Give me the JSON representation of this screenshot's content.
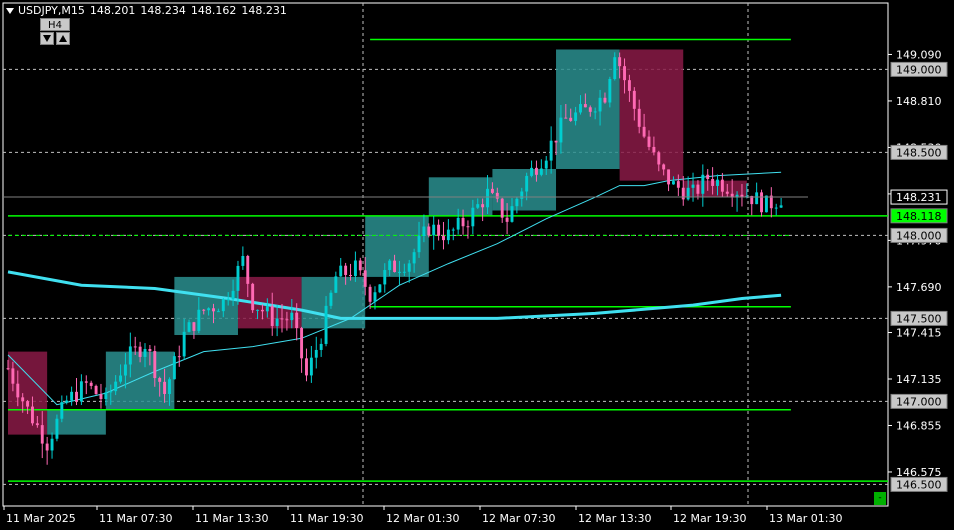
{
  "header": {
    "symbol": "USDJPY,M15",
    "open": "148.201",
    "high": "148.234",
    "low": "148.162",
    "close": "148.231"
  },
  "timeframe": {
    "label": "H4",
    "down_icon": "triangle-down-icon",
    "up_icon": "triangle-up-icon"
  },
  "corner_button": {
    "label": "-"
  },
  "colors": {
    "background": "#000000",
    "frame": "#ffffff",
    "grid": "#c0c0c0",
    "bull": "#00ced1",
    "bear": "#ff69b4",
    "level": "#00ff00",
    "ma_slow": "#40e0f0",
    "ma_fast": "#40e0f0",
    "box_bull": "#2a8f8f",
    "box_bear": "#8a1a46"
  },
  "chart_data": {
    "type": "candlestick",
    "price_min": 146.37,
    "price_max": 149.4,
    "price_ticks": [
      "149.090",
      "148.810",
      "148.530",
      "148.250",
      "147.970",
      "147.690",
      "147.415",
      "147.135",
      "146.855",
      "146.575"
    ],
    "price_tick_values": [
      149.09,
      148.81,
      148.53,
      148.25,
      147.97,
      147.69,
      147.415,
      147.135,
      146.855,
      146.575
    ],
    "time_labels": [
      "11 Mar 2025",
      "11 Mar 07:30",
      "11 Mar 13:30",
      "11 Mar 19:30",
      "12 Mar 01:30",
      "12 Mar 07:30",
      "12 Mar 13:30",
      "12 Mar 19:30",
      "13 Mar 01:30"
    ],
    "bars_total": 160,
    "round_levels": [
      {
        "label": "149.000",
        "value": 149.0
      },
      {
        "label": "148.500",
        "value": 148.5
      },
      {
        "label": "148.000",
        "value": 148.0
      },
      {
        "label": "147.500",
        "value": 147.5
      },
      {
        "label": "147.000",
        "value": 147.0
      },
      {
        "label": "146.500",
        "value": 146.5
      }
    ],
    "current_price": {
      "label": "148.231",
      "value": 148.231
    },
    "marked_level": {
      "label": "148.118",
      "value": 148.118
    },
    "level_lines": [
      {
        "value": 149.18,
        "from": 74,
        "to": 160
      },
      {
        "value": 148.118,
        "from": 0,
        "to": 180
      },
      {
        "value": 147.57,
        "from": 74,
        "to": 160
      },
      {
        "value": 146.95,
        "from": 0,
        "to": 160
      },
      {
        "value": 146.52,
        "from": 0,
        "to": 180
      },
      {
        "value": 148.0,
        "from": 0,
        "to": 160,
        "dashed": true
      }
    ],
    "h4_boxes": [
      {
        "from": 0,
        "to": 8,
        "open": 147.3,
        "close": 146.8,
        "dir": "bear"
      },
      {
        "from": 8,
        "to": 20,
        "open": 146.8,
        "close": 146.95,
        "dir": "bull"
      },
      {
        "from": 20,
        "to": 34,
        "open": 146.95,
        "close": 147.3,
        "dir": "bull"
      },
      {
        "from": 34,
        "to": 47,
        "open": 147.4,
        "close": 147.75,
        "dir": "bull"
      },
      {
        "from": 47,
        "to": 60,
        "open": 147.75,
        "close": 147.44,
        "dir": "bear"
      },
      {
        "from": 60,
        "to": 73,
        "open": 147.44,
        "close": 147.75,
        "dir": "bull"
      },
      {
        "from": 73,
        "to": 86,
        "open": 147.75,
        "close": 148.12,
        "dir": "bull"
      },
      {
        "from": 86,
        "to": 99,
        "open": 148.12,
        "close": 148.35,
        "dir": "bull"
      },
      {
        "from": 99,
        "to": 112,
        "open": 148.15,
        "close": 148.4,
        "dir": "bull"
      },
      {
        "from": 112,
        "to": 125,
        "open": 148.4,
        "close": 149.12,
        "dir": "bull"
      },
      {
        "from": 125,
        "to": 138,
        "open": 149.12,
        "close": 148.33,
        "dir": "bear"
      },
      {
        "from": 138,
        "to": 151,
        "open": 148.33,
        "close": 148.23,
        "dir": "bear"
      }
    ],
    "close_path": [
      [
        0,
        147.2
      ],
      [
        4,
        146.95
      ],
      [
        8,
        146.75
      ],
      [
        12,
        147.0
      ],
      [
        16,
        147.1
      ],
      [
        20,
        147.0
      ],
      [
        24,
        147.25
      ],
      [
        28,
        147.35
      ],
      [
        32,
        147.05
      ],
      [
        36,
        147.4
      ],
      [
        40,
        147.55
      ],
      [
        44,
        147.6
      ],
      [
        48,
        147.85
      ],
      [
        50,
        147.6
      ],
      [
        54,
        147.5
      ],
      [
        58,
        147.5
      ],
      [
        61,
        147.15
      ],
      [
        64,
        147.4
      ],
      [
        67,
        147.75
      ],
      [
        71,
        147.8
      ],
      [
        74,
        147.65
      ],
      [
        78,
        147.8
      ],
      [
        82,
        147.85
      ],
      [
        86,
        148.05
      ],
      [
        90,
        148.0
      ],
      [
        94,
        148.1
      ],
      [
        98,
        148.25
      ],
      [
        102,
        148.1
      ],
      [
        106,
        148.35
      ],
      [
        110,
        148.5
      ],
      [
        114,
        148.7
      ],
      [
        118,
        148.75
      ],
      [
        122,
        148.85
      ],
      [
        124,
        149.12
      ],
      [
        127,
        148.85
      ],
      [
        130,
        148.6
      ],
      [
        133,
        148.4
      ],
      [
        136,
        148.3
      ],
      [
        140,
        148.25
      ],
      [
        143,
        148.35
      ],
      [
        147,
        148.3
      ],
      [
        151,
        148.25
      ],
      [
        155,
        148.18
      ],
      [
        158,
        148.23
      ]
    ],
    "ma_slow": [
      [
        0,
        147.78
      ],
      [
        15,
        147.7
      ],
      [
        30,
        147.68
      ],
      [
        45,
        147.62
      ],
      [
        60,
        147.55
      ],
      [
        68,
        147.5
      ],
      [
        80,
        147.5
      ],
      [
        100,
        147.5
      ],
      [
        120,
        147.53
      ],
      [
        140,
        147.58
      ],
      [
        150,
        147.62
      ],
      [
        158,
        147.64
      ]
    ],
    "ma_fast": [
      [
        0,
        147.28
      ],
      [
        10,
        146.98
      ],
      [
        20,
        147.05
      ],
      [
        30,
        147.18
      ],
      [
        40,
        147.3
      ],
      [
        50,
        147.33
      ],
      [
        60,
        147.38
      ],
      [
        70,
        147.5
      ],
      [
        80,
        147.7
      ],
      [
        90,
        147.83
      ],
      [
        100,
        147.95
      ],
      [
        110,
        148.1
      ],
      [
        120,
        148.23
      ],
      [
        125,
        148.3
      ],
      [
        130,
        148.3
      ],
      [
        135,
        148.33
      ],
      [
        145,
        148.36
      ],
      [
        158,
        148.38
      ]
    ]
  }
}
